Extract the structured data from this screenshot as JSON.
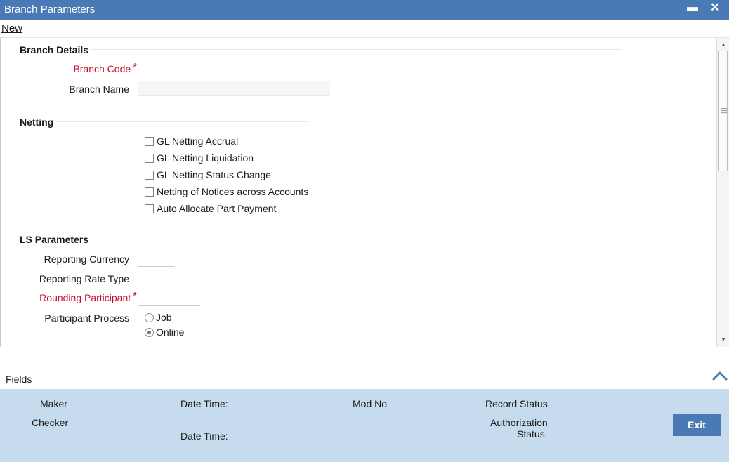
{
  "window": {
    "title": "Branch Parameters",
    "minimize_glyph": "▬",
    "close_glyph": "✕"
  },
  "toolbar": {
    "new_label": "New"
  },
  "branch_details": {
    "title": "Branch Details",
    "branch_code_label": "Branch Code",
    "branch_code_value": "",
    "branch_name_label": "Branch Name",
    "branch_name_value": ""
  },
  "netting": {
    "title": "Netting",
    "options": [
      {
        "label": "GL Netting Accrual",
        "checked": false
      },
      {
        "label": "GL Netting Liquidation",
        "checked": false
      },
      {
        "label": "GL Netting Status Change",
        "checked": false
      },
      {
        "label": "Netting of Notices across Accounts",
        "checked": false
      },
      {
        "label": "Auto Allocate Part Payment",
        "checked": false
      }
    ]
  },
  "ls_parameters": {
    "title": "LS Parameters",
    "reporting_currency_label": "Reporting Currency",
    "reporting_rate_type_label": "Reporting Rate Type",
    "rounding_participant_label": "Rounding Participant",
    "participant_process_label": "Participant Process",
    "participant_process_options": [
      {
        "label": "Job",
        "selected": false
      },
      {
        "label": "Online",
        "selected": true
      }
    ]
  },
  "required_marker": "*",
  "fields_bar": {
    "label": "Fields"
  },
  "footer": {
    "maker_label": "Maker",
    "checker_label": "Checker",
    "date_time_label_1": "Date Time:",
    "date_time_label_2": "Date Time:",
    "mod_no_label": "Mod No",
    "record_status_label": "Record Status",
    "authorization_label_line1": "Authorization",
    "authorization_label_line2": "Status",
    "exit_label": "Exit"
  },
  "colors": {
    "title_bar": "#4a7ab5",
    "required_text": "#c8102e",
    "footer_bg": "#c6dbee",
    "exit_button": "#4a7ab5"
  },
  "icons": {
    "minimize": "minimize-icon",
    "close": "close-icon",
    "collapse": "chevron-up-icon",
    "scroll_up": "scroll-up-arrow-icon",
    "scroll_down": "scroll-down-arrow-icon"
  }
}
